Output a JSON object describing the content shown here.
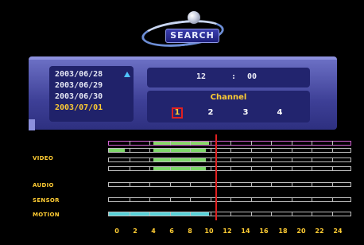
{
  "logo": {
    "text": "SEARCH"
  },
  "dates": {
    "items": [
      "2003/06/28",
      "2003/06/29",
      "2003/06/30",
      "2003/07/01"
    ],
    "selected_index": 3
  },
  "time": {
    "hour": "12",
    "separator": ":",
    "minute": "00"
  },
  "channel": {
    "title": "Channel",
    "options": [
      "1",
      "2",
      "3",
      "4"
    ],
    "selected": "1"
  },
  "timeline": {
    "labels": {
      "video": "VIDEO",
      "audio": "AUDIO",
      "sensor": "SENSOR",
      "motion": "MOTION"
    },
    "hours": [
      "0",
      "2",
      "4",
      "6",
      "8",
      "10",
      "12",
      "14",
      "16",
      "18",
      "20",
      "22",
      "24"
    ],
    "cursor_hour": 12
  },
  "colors": {
    "accent": "#ffcc33",
    "panel": "#3d3f96",
    "cursor": "#e02020",
    "video_record": "#7ed86a",
    "motion_record": "#58d2d8"
  }
}
